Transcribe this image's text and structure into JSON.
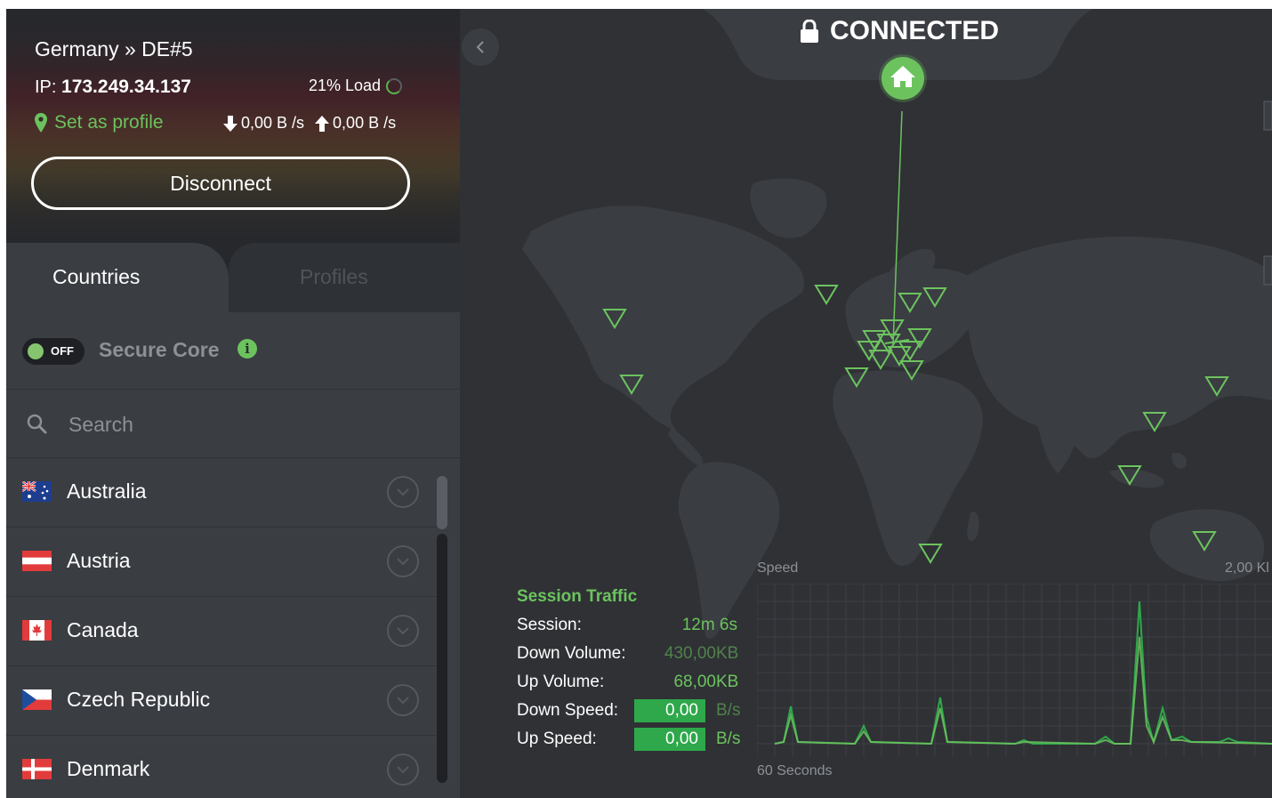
{
  "header": {
    "server": "Germany » DE#5",
    "ip_label": "IP:",
    "ip_value": "173.249.34.137",
    "load": "21% Load",
    "set_profile": "Set as profile",
    "down_speed": "0,00 B /s",
    "up_speed": "0,00 B /s",
    "disconnect": "Disconnect"
  },
  "tabs": {
    "countries": "Countries",
    "profiles": "Profiles"
  },
  "secure_core": {
    "toggle": "OFF",
    "label": "Secure Core"
  },
  "search": {
    "placeholder": "Search"
  },
  "countries": [
    {
      "name": "Australia"
    },
    {
      "name": "Austria"
    },
    {
      "name": "Canada"
    },
    {
      "name": "Czech Republic"
    },
    {
      "name": "Denmark"
    }
  ],
  "status": {
    "label": "CONNECTED"
  },
  "traffic": {
    "title": "Session Traffic",
    "rows": [
      {
        "label": "Session:",
        "value": "12m 6s",
        "unit": ""
      },
      {
        "label": "Down Volume:",
        "value": "430,00",
        "unit": "KB"
      },
      {
        "label": "Up Volume:",
        "value": "68,00",
        "unit": "KB"
      },
      {
        "label": "Down Speed:",
        "value": "0,00",
        "unit": "B/s"
      },
      {
        "label": "Up Speed:",
        "value": "0,00",
        "unit": "B/s"
      }
    ]
  },
  "graph": {
    "speed_label": "Speed",
    "max_label": "2,00 Kl",
    "time_label": "60 Seconds"
  },
  "colors": {
    "accent": "#6cc35e",
    "background": "#2f3135",
    "panel": "#3a3d42"
  }
}
